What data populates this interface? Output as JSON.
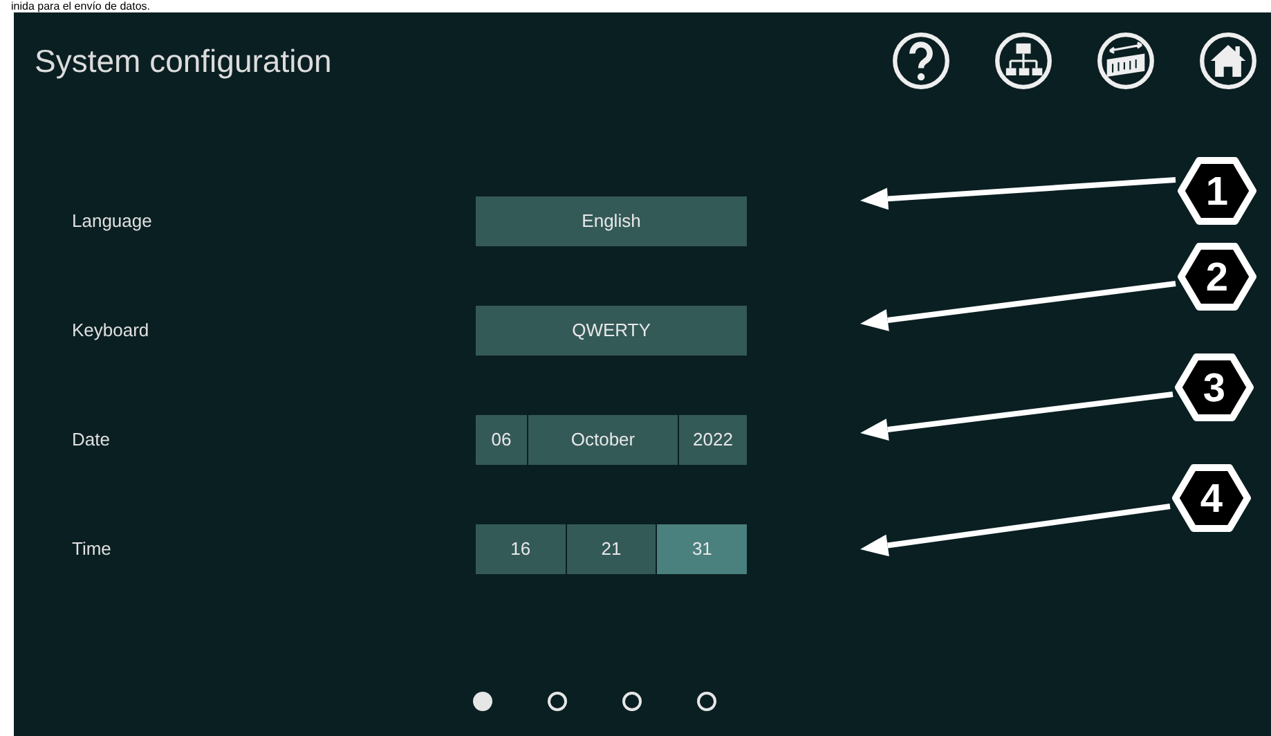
{
  "caption_above": "inida para el envío de datos.",
  "window": {
    "title": "System configuration"
  },
  "header_buttons": [
    {
      "kind": "help"
    },
    {
      "kind": "network"
    },
    {
      "kind": "keyboard"
    },
    {
      "kind": "home"
    }
  ],
  "settings": [
    {
      "label": "Language",
      "kind": "single",
      "value": "English"
    },
    {
      "label": "Keyboard",
      "kind": "single",
      "value": "QWERTY"
    },
    {
      "label": "Date",
      "kind": "segments",
      "segments": [
        {
          "value": "06",
          "selected": false
        },
        {
          "value": "October",
          "selected": false
        },
        {
          "value": "2022",
          "selected": false
        }
      ]
    },
    {
      "label": "Time",
      "kind": "segments",
      "segments": [
        {
          "value": "16",
          "selected": false
        },
        {
          "value": "21",
          "selected": false
        },
        {
          "value": "31",
          "selected": true
        }
      ]
    }
  ],
  "callouts": [
    {
      "label": "1"
    },
    {
      "label": "2"
    },
    {
      "label": "3"
    },
    {
      "label": "4"
    }
  ],
  "page_dots": [
    {
      "selected": true
    },
    {
      "selected": false
    },
    {
      "selected": false
    },
    {
      "selected": false
    }
  ]
}
